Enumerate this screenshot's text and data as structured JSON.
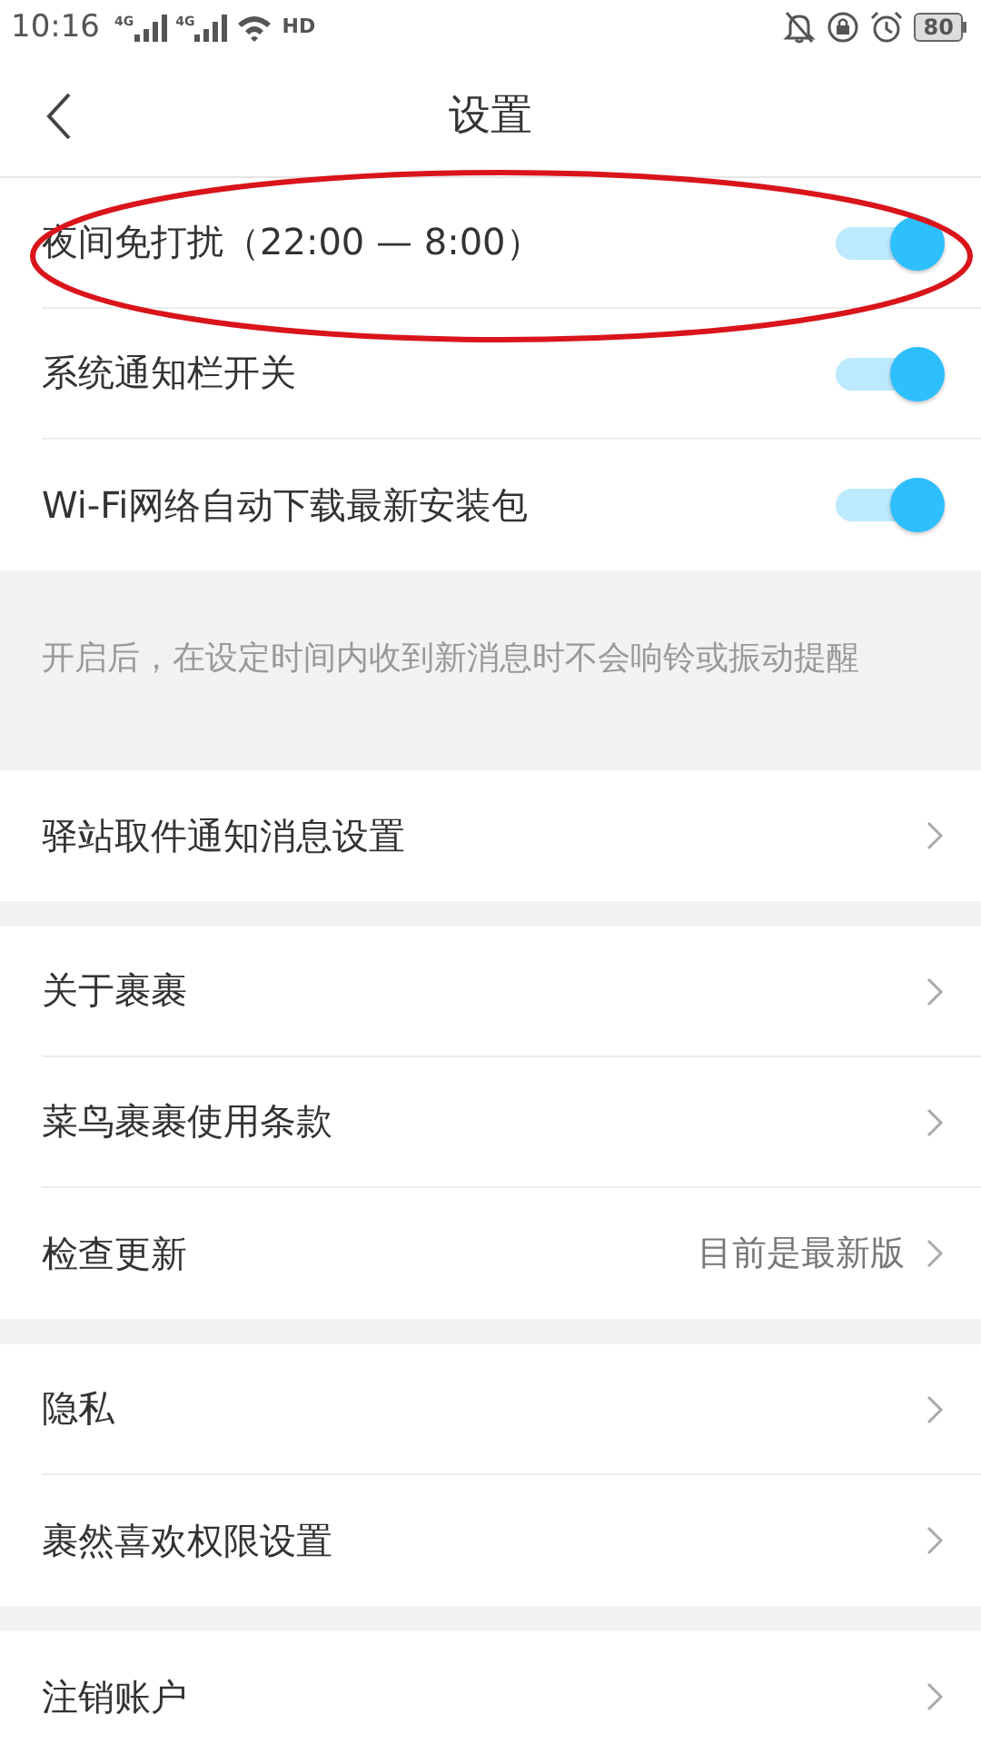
{
  "status_bar": {
    "time": "10:16",
    "sims": [
      {
        "network": "4G"
      },
      {
        "network": "4G"
      }
    ],
    "call_badge": "HD",
    "battery": "80"
  },
  "header": {
    "title": "设置"
  },
  "sections": [
    {
      "kind": "list",
      "items": [
        {
          "kind": "toggle",
          "label": "夜间免打扰（22:00 — 8:00）",
          "on": true,
          "circled": true
        },
        {
          "kind": "toggle",
          "label": "系统通知栏开关",
          "on": true,
          "circled": false
        },
        {
          "kind": "toggle",
          "label": "Wi-Fi网络自动下载最新安装包",
          "on": true,
          "circled": false
        }
      ]
    },
    {
      "kind": "note",
      "text": "开启后，在设定时间内收到新消息时不会响铃或振动提醒"
    },
    {
      "kind": "list",
      "items": [
        {
          "kind": "link",
          "label": "驿站取件通知消息设置"
        }
      ]
    },
    {
      "kind": "list",
      "items": [
        {
          "kind": "link",
          "label": "关于裹裹"
        },
        {
          "kind": "link",
          "label": "菜鸟裹裹使用条款"
        },
        {
          "kind": "link",
          "label": "检查更新",
          "value": "目前是最新版"
        }
      ]
    },
    {
      "kind": "list",
      "items": [
        {
          "kind": "link",
          "label": "隐私"
        },
        {
          "kind": "link",
          "label": "裹然喜欢权限设置"
        }
      ]
    },
    {
      "kind": "list",
      "items": [
        {
          "kind": "link",
          "label": "注销账户"
        }
      ]
    }
  ]
}
